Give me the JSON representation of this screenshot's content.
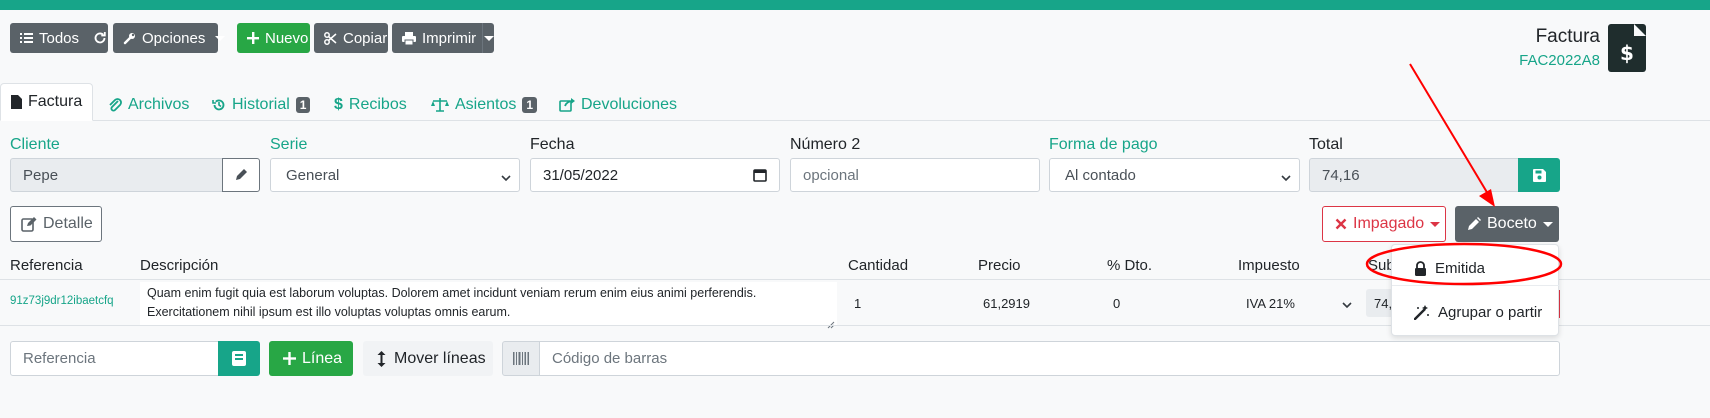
{
  "toolbar": {
    "all_label": "Todos",
    "options_label": "Opciones",
    "new_label": "Nuevo",
    "copy_label": "Copiar",
    "print_label": "Imprimir"
  },
  "document": {
    "title": "Factura",
    "code": "FAC2022A8"
  },
  "tabs": [
    {
      "label": "Factura",
      "badge": ""
    },
    {
      "label": "Archivos",
      "badge": ""
    },
    {
      "label": "Historial",
      "badge": "1"
    },
    {
      "label": "Recibos",
      "badge": ""
    },
    {
      "label": "Asientos",
      "badge": "1"
    },
    {
      "label": "Devoluciones",
      "badge": ""
    }
  ],
  "form": {
    "client_label": "Cliente",
    "client_value": "Pepe",
    "serie_label": "Serie",
    "serie_value": "General",
    "date_label": "Fecha",
    "date_value": "31/05/2022",
    "number2_label": "Número 2",
    "number2_placeholder": "opcional",
    "payment_label": "Forma de pago",
    "payment_value": "Al contado",
    "total_label": "Total",
    "total_value": "74,16"
  },
  "actions": {
    "detail_label": "Detalle",
    "unpaid_label": "Impagado",
    "status_label": "Boceto"
  },
  "status_menu": {
    "items": [
      "Emitida",
      "Agrupar o partir"
    ]
  },
  "table": {
    "headers": {
      "reference": "Referencia",
      "description": "Descripción",
      "quantity": "Cantidad",
      "price": "Precio",
      "discount": "% Dto.",
      "tax": "Impuesto",
      "subtotal": "Sub"
    },
    "rows": [
      {
        "reference": "91z73j9dr12ibaetcfq",
        "description_line1": "Quam enim fugit quia est laborum voluptas. Dolorem amet incidunt veniam rerum enim eius animi perferendis.",
        "description_line2": "Exercitationem nihil ipsum est illo voluptas voluptas omnis earum.",
        "quantity": "1",
        "price": "61,2919",
        "discount": "0",
        "tax": "IVA 21%",
        "subtotal": "74,"
      }
    ]
  },
  "bottom": {
    "reference_placeholder": "Referencia",
    "line_label": "Línea",
    "move_lines_label": "Mover líneas",
    "barcode_placeholder": "Código de barras"
  },
  "colors": {
    "accent": "#17a589",
    "annotation": "#ff0000"
  }
}
